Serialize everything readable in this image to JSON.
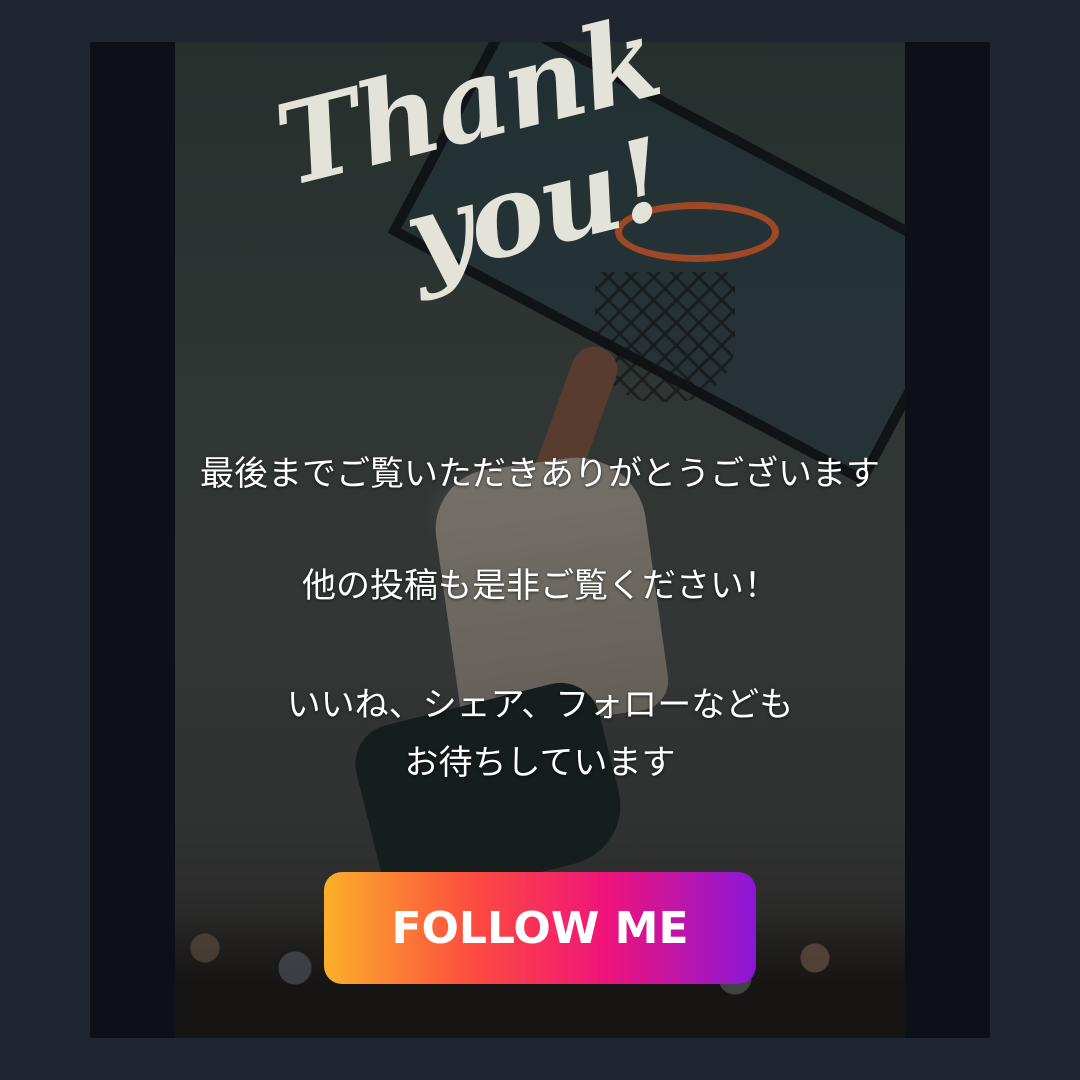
{
  "headline": {
    "line1": "Thank",
    "line2": "you!"
  },
  "messages": {
    "line1": "最後までご覧いただきありがとうございます",
    "line2": "他の投稿も是非ご覧ください！",
    "line3a": "いいね、シェア、フォローなども",
    "line3b": "お待ちしています"
  },
  "follow_button": {
    "label": "FOLLOW ME"
  },
  "colors": {
    "page_background": "#1f2631",
    "headline": "#e3e3da",
    "button_gradient": [
      "#fbb02a",
      "#fc4a3f",
      "#f0147a",
      "#8b16d8"
    ]
  }
}
